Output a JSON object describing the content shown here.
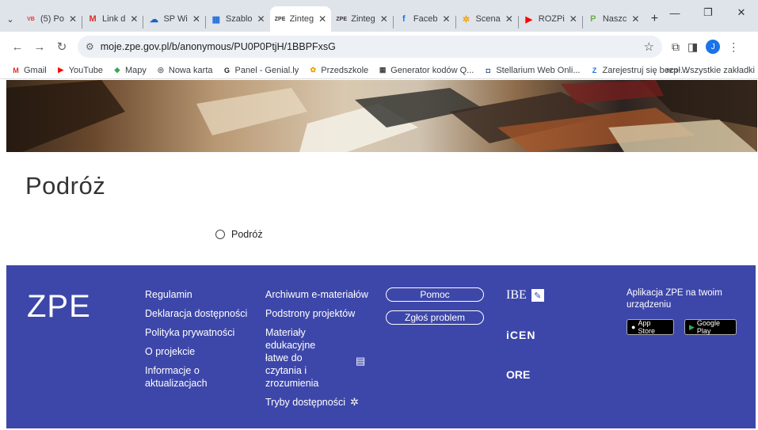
{
  "browser": {
    "tabs": [
      {
        "title": "(5) Po",
        "icon_text": "VB",
        "icon_color": "#e53935"
      },
      {
        "title": "Link d",
        "icon_text": "M",
        "icon_color": "#d93025"
      },
      {
        "title": "SP Wi",
        "icon_text": "☁",
        "icon_color": "#1565c0"
      },
      {
        "title": "Szablo",
        "icon_text": "▦",
        "icon_color": "#1e6fd9"
      },
      {
        "title": "Zinteg",
        "icon_text": "ZPE",
        "icon_color": "#333333",
        "active": true
      },
      {
        "title": "Zinteg",
        "icon_text": "ZPE",
        "icon_color": "#333333"
      },
      {
        "title": "Faceb",
        "icon_text": "f",
        "icon_color": "#1877f2"
      },
      {
        "title": "Scena",
        "icon_text": "✲",
        "icon_color": "#f4a300"
      },
      {
        "title": "ROZPi",
        "icon_text": "▶",
        "icon_color": "#ff0000"
      },
      {
        "title": "Naszc",
        "icon_text": "P",
        "icon_color": "#6ab04c"
      }
    ],
    "url": "moje.zpe.gov.pl/b/anonymous/PU0P0PtjH/1BBPFxsG",
    "avatar_letter": "J",
    "bookmarks": [
      {
        "label": "Gmail",
        "icon_text": "M",
        "icon_color": "#d93025"
      },
      {
        "label": "YouTube",
        "icon_text": "▶",
        "icon_color": "#ff0000"
      },
      {
        "label": "Mapy",
        "icon_text": "◆",
        "icon_color": "#34a853"
      },
      {
        "label": "Nowa karta",
        "icon_text": "◎",
        "icon_color": "#5f6368"
      },
      {
        "label": "Panel - Genial.ly",
        "icon_text": "G",
        "icon_color": "#222222"
      },
      {
        "label": "Przedszkole",
        "icon_text": "✿",
        "icon_color": "#e8a400"
      },
      {
        "label": "Generator kodów Q...",
        "icon_text": "▦",
        "icon_color": "#444444"
      },
      {
        "label": "Stellarium Web Onli...",
        "icon_text": "◘",
        "icon_color": "#1f3a68"
      },
      {
        "label": "Zarejestruj się bezpł...",
        "icon_text": "Z",
        "icon_color": "#1e6fd9"
      }
    ],
    "bookmarks_more": "»",
    "all_bookmarks": "Wszystkie zakładki"
  },
  "page": {
    "title": "Podróż",
    "radio_label": "Podróż"
  },
  "footer": {
    "logo": "ZPE",
    "col1": [
      "Regulamin",
      "Deklaracja dostępności",
      "Polityka prywatności",
      "O projekcie",
      "Informacje o aktualizacjach"
    ],
    "col2": [
      "Archiwum e-materiałów",
      "Podstrony projektów",
      "Materiały edukacyjne łatwe do czytania i zrozumienia",
      "Tryby dostępności"
    ],
    "help_button": "Pomoc",
    "report_button": "Zgłoś problem",
    "partners": [
      "IBE",
      "iCEN",
      "ORE"
    ],
    "app_title": "Aplikacja ZPE na twoim urządzeniu",
    "app_store": "App Store",
    "google_play": "Google Play"
  }
}
